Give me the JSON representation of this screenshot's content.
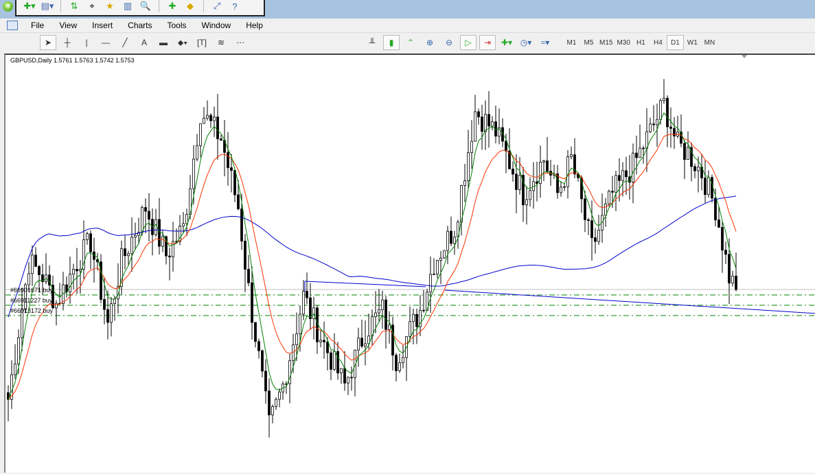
{
  "menu": [
    "File",
    "View",
    "Insert",
    "Charts",
    "Tools",
    "Window",
    "Help"
  ],
  "timeframes": [
    {
      "label": "M1"
    },
    {
      "label": "M5"
    },
    {
      "label": "M15"
    },
    {
      "label": "M30"
    },
    {
      "label": "H1"
    },
    {
      "label": "H4"
    },
    {
      "label": "D1",
      "active": true
    },
    {
      "label": "W1"
    },
    {
      "label": "MN"
    }
  ],
  "chart": {
    "symbol_line": "GBPUSD,Daily  1.5761 1.5763 1.5742 1.5753",
    "current_price": 1.5753,
    "orders": [
      {
        "label": "#66901671 buy",
        "price": 1.5745
      },
      {
        "label": "#66911227 buy",
        "price": 1.573
      },
      {
        "label": "#66913172 buy",
        "price": 1.5715
      }
    ],
    "colors": {
      "fast_ma": "#008000",
      "slow_ma": "#ff3300",
      "long_ma": "#0000cc",
      "order_line": "#008000"
    },
    "key_closes": [
      [
        0,
        1.5593
      ],
      [
        6,
        1.5793
      ],
      [
        10,
        1.5773
      ],
      [
        14,
        1.5733
      ],
      [
        20,
        1.5793
      ],
      [
        24,
        1.5823
      ],
      [
        29,
        1.5703
      ],
      [
        33,
        1.5793
      ],
      [
        40,
        1.5873
      ],
      [
        46,
        1.5803
      ],
      [
        51,
        1.5843
      ],
      [
        56,
        1.6013
      ],
      [
        62,
        1.5973
      ],
      [
        67,
        1.5873
      ],
      [
        70,
        1.5753
      ],
      [
        76,
        1.5553
      ],
      [
        80,
        1.5613
      ],
      [
        86,
        1.5743
      ],
      [
        92,
        1.5673
      ],
      [
        98,
        1.5613
      ],
      [
        104,
        1.5693
      ],
      [
        109,
        1.5723
      ],
      [
        113,
        1.5653
      ],
      [
        120,
        1.5723
      ],
      [
        124,
        1.5793
      ],
      [
        130,
        1.5843
      ],
      [
        136,
        1.6013
      ],
      [
        142,
        1.5983
      ],
      [
        150,
        1.5893
      ],
      [
        156,
        1.5943
      ],
      [
        160,
        1.5893
      ],
      [
        164,
        1.5943
      ],
      [
        170,
        1.5813
      ],
      [
        176,
        1.5893
      ],
      [
        182,
        1.5933
      ],
      [
        188,
        1.5993
      ],
      [
        191,
        1.6023
      ],
      [
        195,
        1.5963
      ],
      [
        198,
        1.5953
      ],
      [
        202,
        1.5923
      ],
      [
        206,
        1.5873
      ],
      [
        210,
        1.5773
      ],
      [
        212,
        1.5753
      ]
    ]
  }
}
